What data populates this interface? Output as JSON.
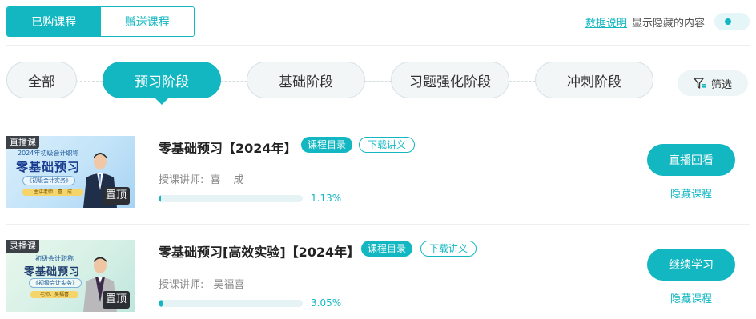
{
  "top_tabs": [
    {
      "label": "已购课程",
      "active": true
    },
    {
      "label": "赠送课程",
      "active": false
    }
  ],
  "header_right": {
    "data_link": "数据说明",
    "show_hidden_label": "显示隐藏的内容",
    "toggle_on": false
  },
  "stages": [
    {
      "label": "全部",
      "active": false
    },
    {
      "label": "预习阶段",
      "active": true
    },
    {
      "label": "基础阶段",
      "active": false
    },
    {
      "label": "习题强化阶段",
      "active": false
    },
    {
      "label": "冲刺阶段",
      "active": false
    }
  ],
  "filter_label": "筛选",
  "courses": [
    {
      "thumb": {
        "tag": "直播课",
        "subtitle": "2024年初级会计职称",
        "title": "零基础预习",
        "badge": "《初级会计实务》",
        "footer": "主讲老师：喜　成"
      },
      "pin_label": "置顶",
      "title": "零基础预习【2024年】",
      "tag_catalog": "课程目录",
      "tag_download": "下载讲义",
      "teacher_label": "授课讲师:",
      "teacher_name": "喜 成",
      "progress_value": 1.13,
      "progress_text": "1.13%",
      "action_label": "直播回看",
      "hide_label": "隐藏课程"
    },
    {
      "thumb": {
        "tag": "录播课",
        "subtitle": "初级会计职称",
        "title": "零基础预习",
        "badge": "《初级会计实务》",
        "footer": "老师：吴福喜"
      },
      "pin_label": "置顶",
      "title": "零基础预习[高效实验]【2024年】",
      "tag_catalog": "课程目录",
      "tag_download": "下载讲义",
      "teacher_label": "授课讲师:",
      "teacher_name": "吴福喜",
      "progress_value": 3.05,
      "progress_text": "3.05%",
      "action_label": "继续学习",
      "hide_label": "隐藏课程"
    }
  ],
  "colors": {
    "accent": "#12b7c2",
    "pill_bg": "#f2f6f7",
    "text_muted": "#888888"
  }
}
